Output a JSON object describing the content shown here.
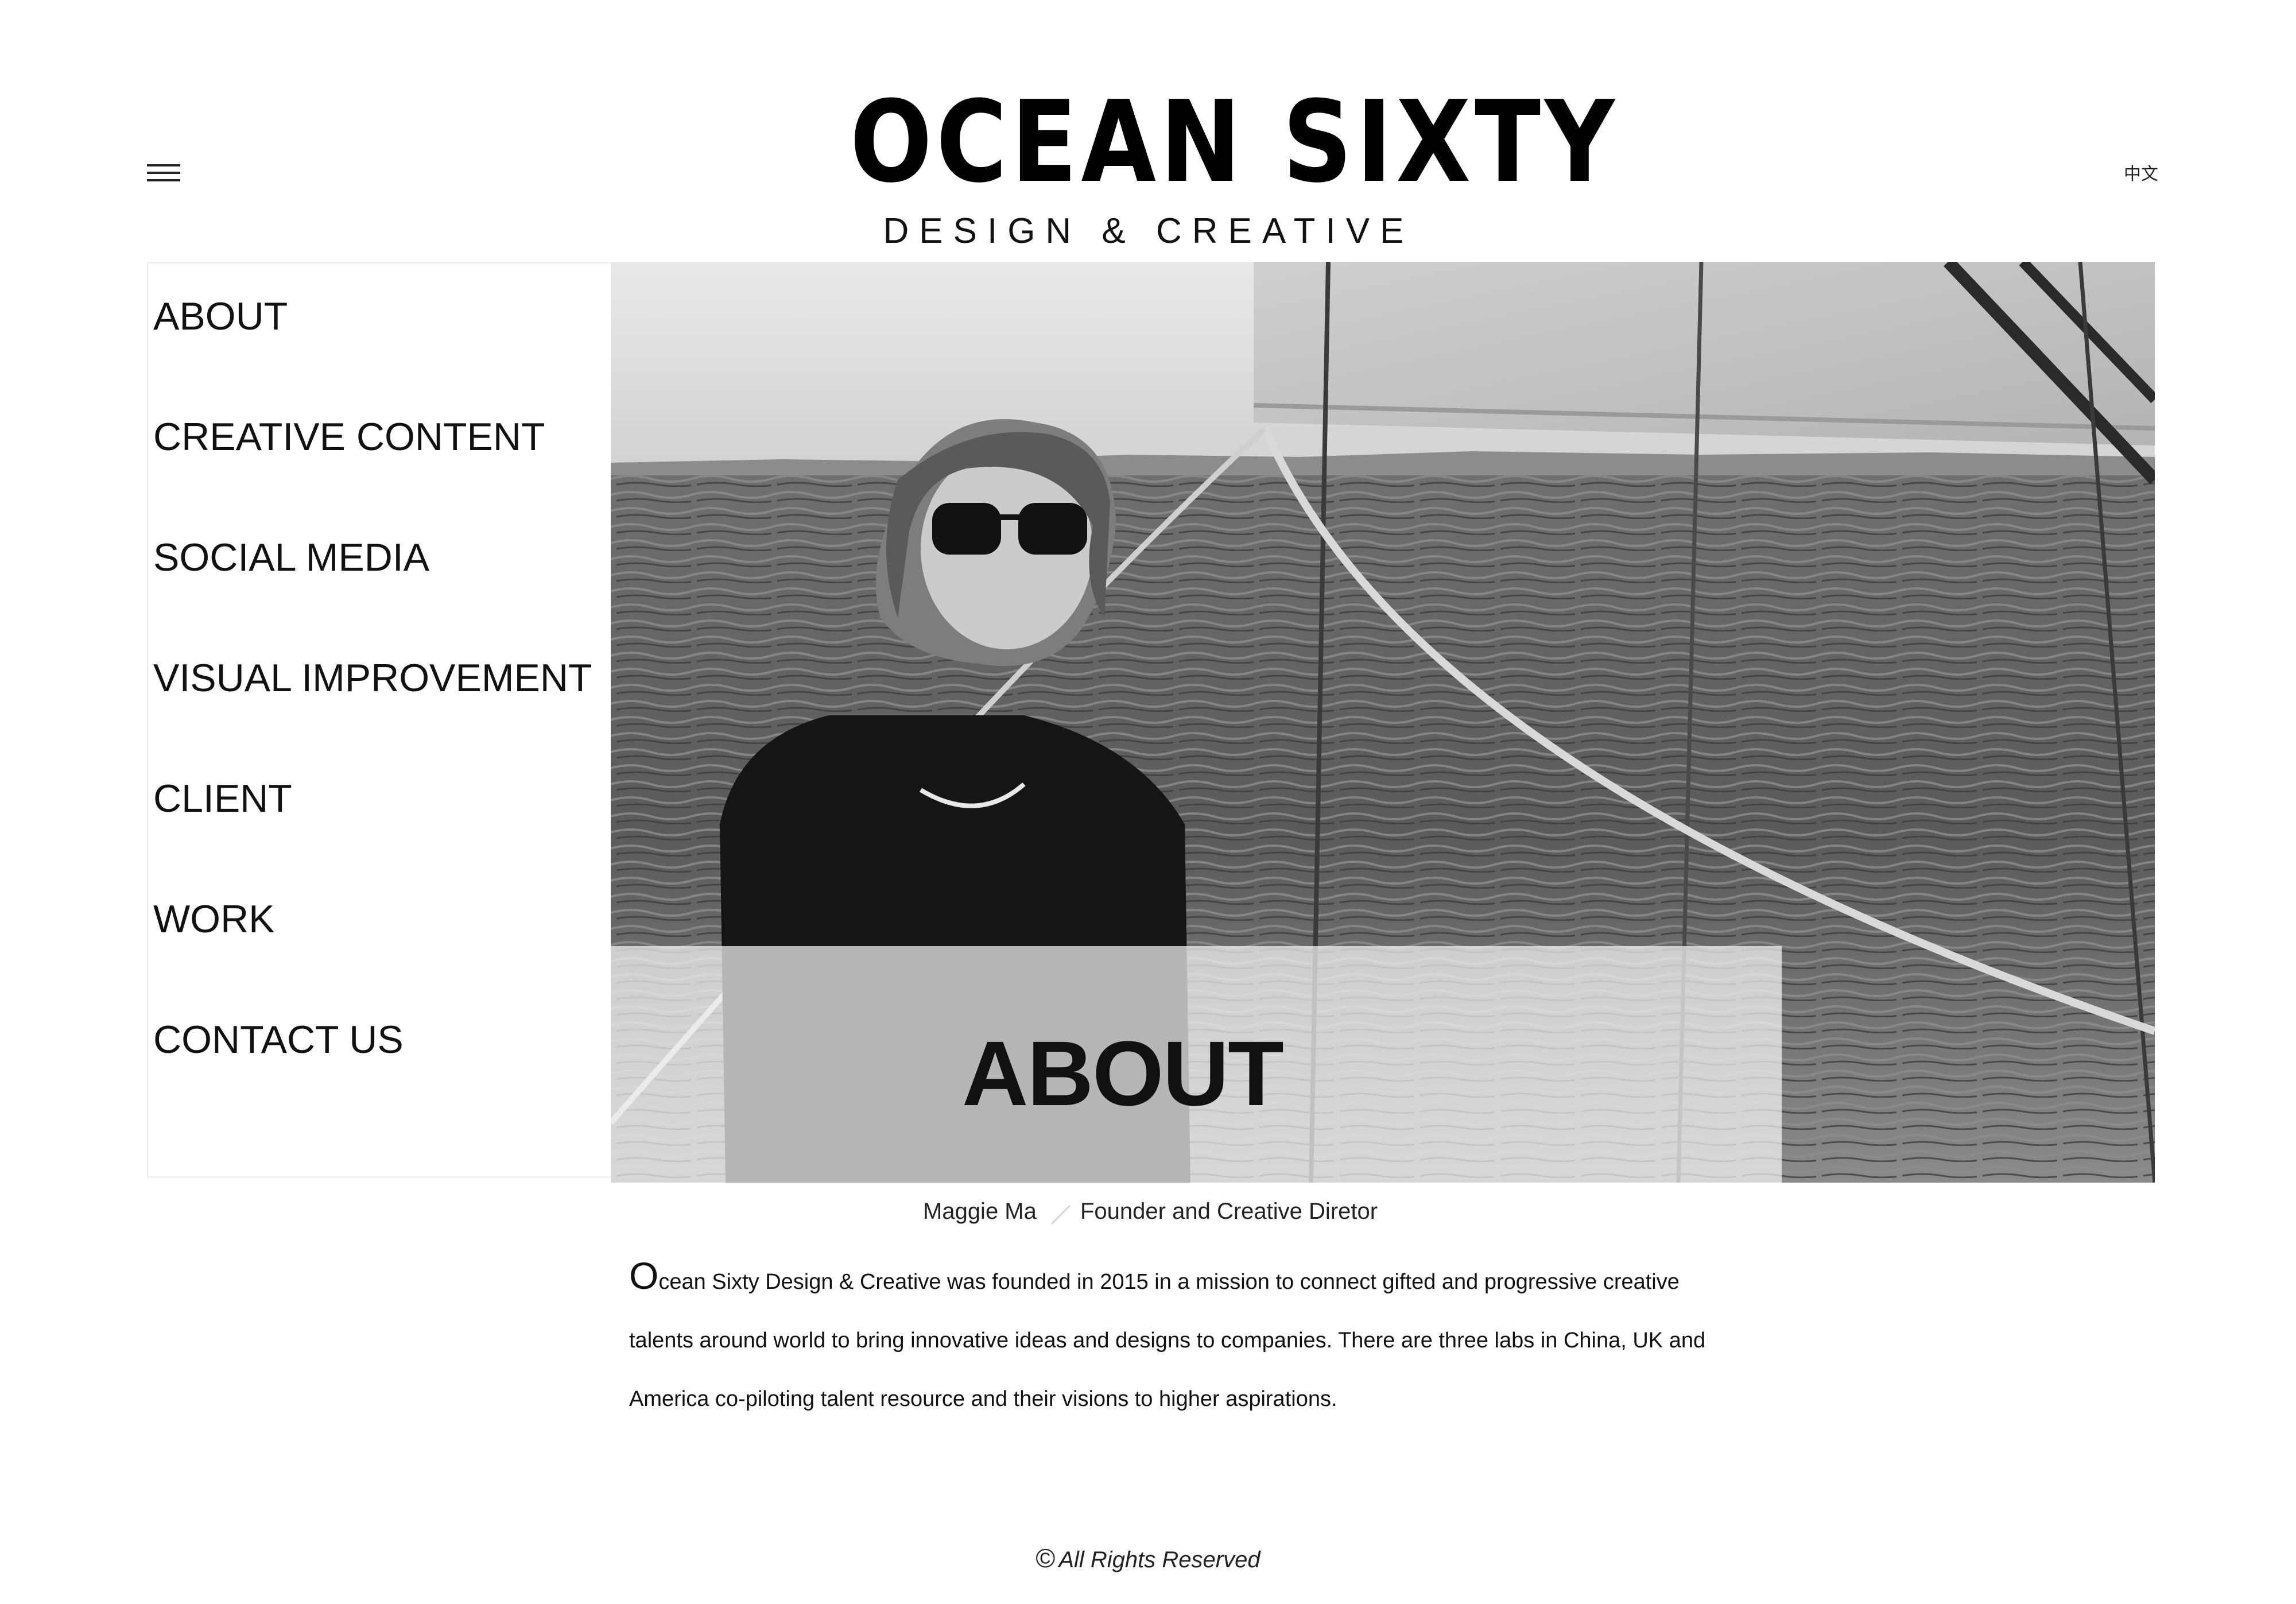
{
  "header": {
    "logo_title": "OCEAN SIXTY",
    "logo_subtitle": "DESIGN & CREATIVE",
    "language_link": "中文",
    "menu_icon": "hamburger-menu-icon"
  },
  "nav": {
    "items": [
      {
        "label": "ABOUT"
      },
      {
        "label": "CREATIVE CONTENT"
      },
      {
        "label": "SOCIAL MEDIA"
      },
      {
        "label": "VISUAL IMPROVEMENT"
      },
      {
        "label": "CLIENT"
      },
      {
        "label": "WORK"
      },
      {
        "label": "CONTACT US"
      }
    ]
  },
  "hero": {
    "title": "ABOUT"
  },
  "person": {
    "name": "Maggie Ma",
    "role": "Founder and Creative Diretor"
  },
  "bio": {
    "dropcap": "O",
    "text": "cean Sixty Design & Creative was founded in 2015 in a mission to connect gifted and progressive creative talents around world to bring innovative ideas and designs to companies. There are three labs in China, UK and America co-piloting talent resource and their visions to higher aspirations."
  },
  "footer": {
    "copyright_symbol": "©",
    "text": "All Rights Reserved"
  },
  "colors": {
    "text": "#111111",
    "caption_overlay": "#f5f5f5",
    "background": "#ffffff"
  }
}
